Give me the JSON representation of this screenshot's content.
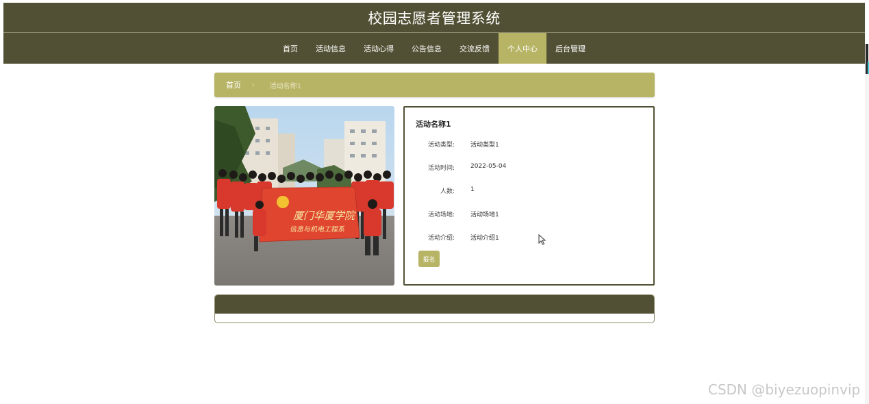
{
  "header": {
    "title": "校园志愿者管理系统"
  },
  "nav": {
    "items": [
      {
        "label": "首页"
      },
      {
        "label": "活动信息"
      },
      {
        "label": "活动心得"
      },
      {
        "label": "公告信息"
      },
      {
        "label": "交流反馈"
      },
      {
        "label": "个人中心",
        "active": true
      },
      {
        "label": "后台管理"
      }
    ]
  },
  "breadcrumb": {
    "home": "首页",
    "separator": "›",
    "current": "活动名称1"
  },
  "detail": {
    "title": "活动名称1",
    "rows": [
      {
        "label": "活动类型:",
        "value": "活动类型1"
      },
      {
        "label": "活动时间:",
        "value": "2022-05-04"
      },
      {
        "label": "人数:",
        "value": "1"
      },
      {
        "label": "活动场地:",
        "value": "活动场地1"
      },
      {
        "label": "活动介绍:",
        "value": "活动介绍1"
      }
    ],
    "signup_label": "报名"
  },
  "photo": {
    "banner_line1": "厦门华厦学院",
    "banner_line2": "信息与机电工程系"
  },
  "watermark": "CSDN @biyezuopinvip",
  "colors": {
    "header_bg": "#525034",
    "accent": "#b8b466",
    "text_light": "#ffffff"
  }
}
